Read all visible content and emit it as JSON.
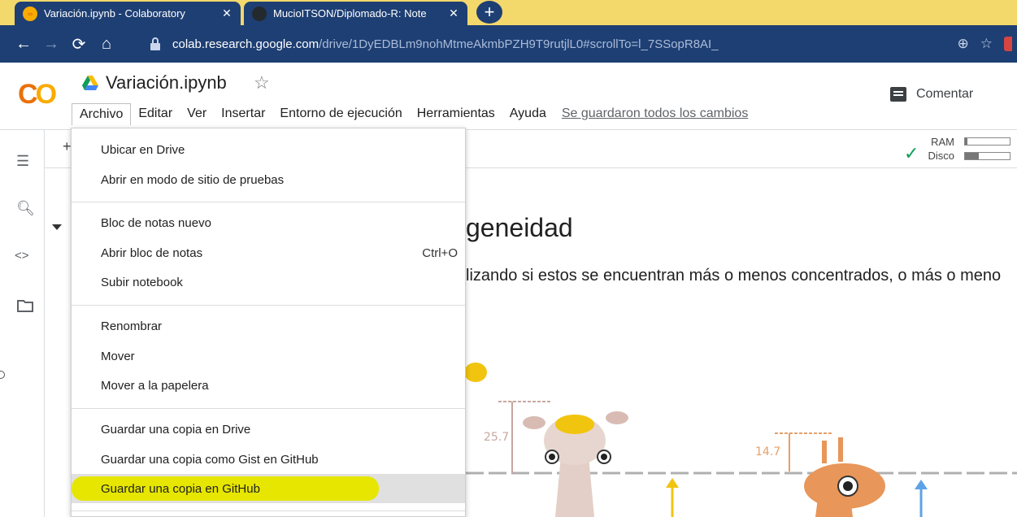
{
  "browser": {
    "tabs": [
      {
        "title": "Variación.ipynb - Colaboratory",
        "icon": "colab-favicon",
        "active": true
      },
      {
        "title": "MucioITSON/Diplomado-R: Note",
        "icon": "github-favicon",
        "active": false
      }
    ],
    "close_glyph": "✕",
    "new_tab_glyph": "+",
    "url_host": "colab.research.google.com",
    "url_path": "/drive/1DyEDBLm9nohMtmeAkmbPZH9T9rutjlL0#scrollTo=l_7SSopR8AI_",
    "toolbar_colors": {
      "tabstrip": "#f3d86b",
      "toolbar": "#1e3f73"
    }
  },
  "colab": {
    "logo_left": "C",
    "logo_right": "O",
    "notebook_title": "Variación.ipynb",
    "menu": [
      "Archivo",
      "Editar",
      "Ver",
      "Insertar",
      "Entorno de ejecución",
      "Herramientas",
      "Ayuda"
    ],
    "saved_status": "Se guardaron todos los cambios",
    "comment_label": "Comentar",
    "ram_label": "RAM",
    "disk_label": "Disco",
    "ram_usage": 0.05,
    "disk_usage": 0.3,
    "add_cell_glyph": "+"
  },
  "content": {
    "heading_fragment": "geneidad",
    "paragraph_fragment": "lizando si estos se encuentran más o menos concentrados, o más o meno",
    "illustration_labels": [
      "25.7",
      "14.7"
    ]
  },
  "file_menu": {
    "groups": [
      [
        {
          "label": "Ubicar en Drive"
        },
        {
          "label": "Abrir en modo de sitio de pruebas"
        }
      ],
      [
        {
          "label": "Bloc de notas nuevo"
        },
        {
          "label": "Abrir bloc de notas",
          "shortcut": "Ctrl+O"
        },
        {
          "label": "Subir notebook"
        }
      ],
      [
        {
          "label": "Renombrar"
        },
        {
          "label": "Mover"
        },
        {
          "label": "Mover a la papelera"
        }
      ],
      [
        {
          "label": "Guardar una copia en Drive"
        },
        {
          "label": "Guardar una copia como Gist en GitHub"
        },
        {
          "label": "Guardar una copia en GitHub",
          "highlighted": true
        }
      ]
    ],
    "highlight_color": "#e6e600"
  }
}
